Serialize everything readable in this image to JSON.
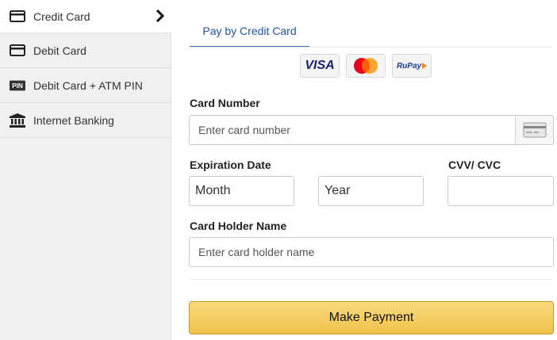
{
  "sidebar": {
    "items": [
      {
        "label": "Credit Card",
        "active": true,
        "icon": "credit-card-icon"
      },
      {
        "label": "Debit Card",
        "active": false,
        "icon": "debit-card-icon"
      },
      {
        "label": "Debit Card + ATM PIN",
        "active": false,
        "icon": "pin-icon"
      },
      {
        "label": "Internet Banking",
        "active": false,
        "icon": "bank-icon"
      }
    ]
  },
  "tab": {
    "label": "Pay by Credit Card"
  },
  "logos": {
    "visa": "VISA",
    "rupay": "RuPay"
  },
  "form": {
    "card_number": {
      "label": "Card Number",
      "placeholder": "Enter card number"
    },
    "expiration": {
      "label": "Expiration Date",
      "month": "Month",
      "year": "Year"
    },
    "cvv": {
      "label": "CVV/ CVC",
      "value": ""
    },
    "holder": {
      "label": "Card Holder Name",
      "placeholder": "Enter card holder name"
    }
  },
  "submit": {
    "label": "Make Payment"
  },
  "colors": {
    "accent": "#3f6fb5",
    "button": "#f0c14b",
    "sidebar_bg": "#f0f0f0"
  }
}
